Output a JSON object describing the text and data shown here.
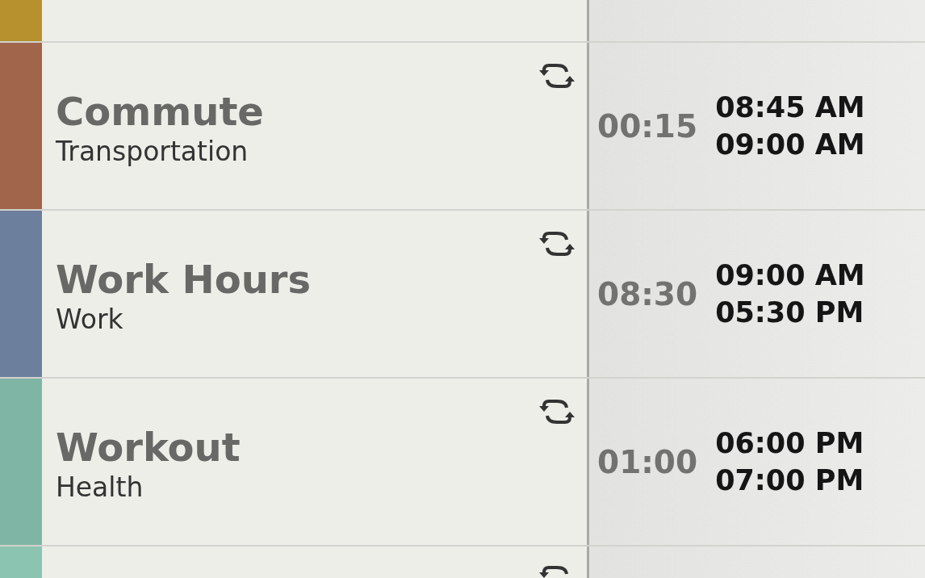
{
  "top_partial": {
    "color": "#b8912f"
  },
  "entries": [
    {
      "title": "Commute",
      "category": "Transportation",
      "color": "#a0654a",
      "repeating": true,
      "duration": "00:15",
      "start": "08:45 AM",
      "end": "09:00 AM"
    },
    {
      "title": "Work Hours",
      "category": "Work",
      "color": "#6c7f9c",
      "repeating": true,
      "duration": "08:30",
      "start": "09:00 AM",
      "end": "05:30 PM"
    },
    {
      "title": "Workout",
      "category": "Health",
      "color": "#7fb5a4",
      "repeating": true,
      "duration": "01:00",
      "start": "06:00 PM",
      "end": "07:00 PM"
    }
  ],
  "bottom_partial": {
    "color": "#8cc4b2",
    "repeating": true
  }
}
